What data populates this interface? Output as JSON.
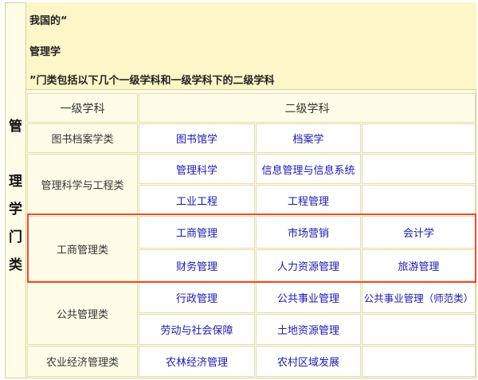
{
  "side_label": [
    "管",
    "理",
    "学",
    "门",
    "类"
  ],
  "header": {
    "line1": "我国的“",
    "line2": "管理学",
    "line3": "”门类包括以下几个一级学科和一级学科下的二级学科"
  },
  "columns": {
    "first": "一级学科",
    "second": "二级学科"
  },
  "rows": {
    "r0": {
      "category": "图书档案学类",
      "subs": [
        "图书馆学",
        "档案学",
        ""
      ]
    },
    "r1": {
      "category": "管理科学与工程类",
      "subs_a": [
        "管理科学",
        "信息管理与信息系统",
        ""
      ],
      "subs_b": [
        "工业工程",
        "工程管理",
        ""
      ]
    },
    "r2": {
      "category": "工商管理类",
      "subs_a": [
        "工商管理",
        "市场营销",
        "会计学"
      ],
      "subs_b": [
        "财务管理",
        "人力资源管理",
        "旅游管理"
      ]
    },
    "r3": {
      "category": "公共管理类",
      "subs_a": [
        "行政管理",
        "公共事业管理",
        "公共事业管理（师范类）"
      ],
      "subs_b": [
        "劳动与社会保障",
        "土地资源管理",
        ""
      ]
    },
    "r4": {
      "category": "农业经济管理类",
      "subs": [
        "农林经济管理",
        "农村区域发展",
        ""
      ]
    }
  },
  "colors": {
    "highlight_border": "#ee4a2f",
    "link_text": "#1a1ab0",
    "header_bg": "#fdf6c8"
  }
}
